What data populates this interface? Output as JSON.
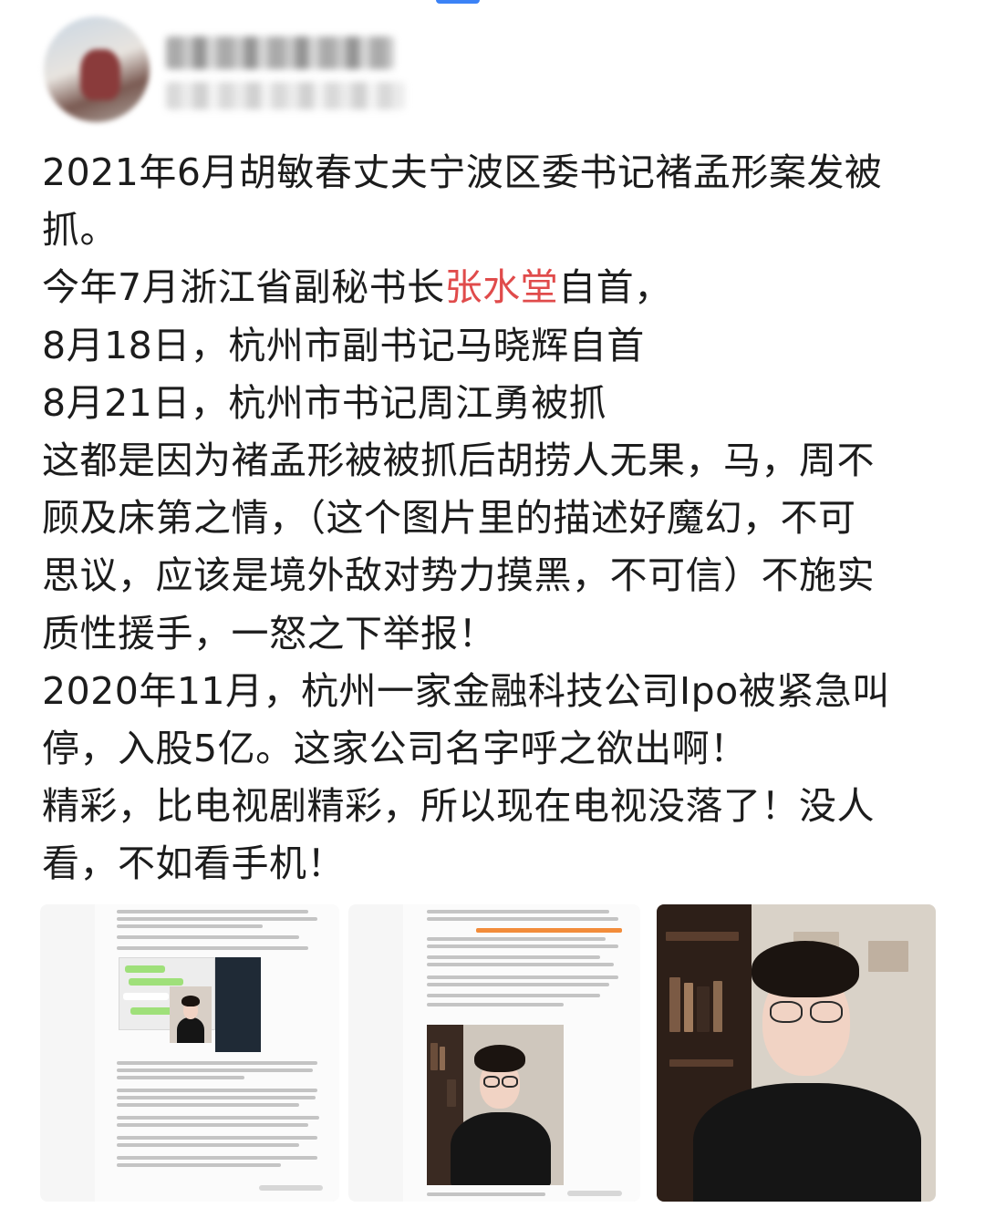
{
  "post": {
    "lines": [
      "2021年6月胡敏春丈夫宁波区委书记褚孟形案发被",
      "抓。",
      "今年7月浙江省副秘书长",
      "8月18日，杭州市副书记马晓辉自首",
      "8月21日，杭州市书记周江勇被抓",
      "这都是因为褚孟形被被抓后胡捞人无果，马，周不",
      "顾及床第之情，（这个图片里的描述好魔幻，不可",
      "思议，应该是境外敌对势力摸黑，不可信）不施实",
      "质性援手，一怒之下举报！",
      "2020年11月，杭州一家金融科技公司Ipo被紧急叫",
      "停，入股5亿。这家公司名字呼之欲出啊！",
      "精彩，比电视剧精彩，所以现在电视没落了！没人",
      "看，不如看手机！"
    ],
    "highlighted_name": "张水堂",
    "line3_suffix": "自首，"
  },
  "colors": {
    "highlight": "#e04b4b",
    "text": "#1c1c1c",
    "accent": "#3b82f6"
  },
  "images": [
    {
      "kind": "article-screenshot-with-chat"
    },
    {
      "kind": "article-screenshot-with-portrait"
    },
    {
      "kind": "portrait-photo"
    }
  ]
}
